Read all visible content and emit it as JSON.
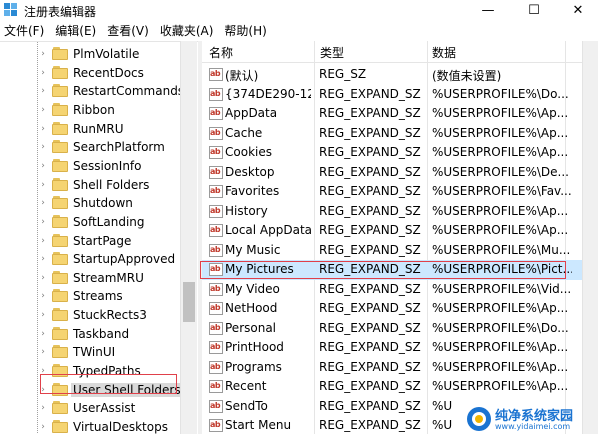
{
  "window": {
    "title": "注册表编辑器",
    "controls": {
      "minimize": "—",
      "maximize": "☐",
      "close": "✕"
    }
  },
  "menu": [
    "文件(F)",
    "编辑(E)",
    "查看(V)",
    "收藏夹(A)",
    "帮助(H)"
  ],
  "tree": {
    "items": [
      {
        "label": "PlmVolatile",
        "expanded": false
      },
      {
        "label": "RecentDocs",
        "expanded": false
      },
      {
        "label": "RestartCommands",
        "expanded": false
      },
      {
        "label": "Ribbon",
        "expanded": false
      },
      {
        "label": "RunMRU",
        "expanded": false
      },
      {
        "label": "SearchPlatform",
        "expanded": false
      },
      {
        "label": "SessionInfo",
        "expanded": false
      },
      {
        "label": "Shell Folders",
        "expanded": false
      },
      {
        "label": "Shutdown",
        "expanded": false
      },
      {
        "label": "SoftLanding",
        "expanded": false
      },
      {
        "label": "StartPage",
        "expanded": false
      },
      {
        "label": "StartupApproved",
        "expanded": false
      },
      {
        "label": "StreamMRU",
        "expanded": false
      },
      {
        "label": "Streams",
        "expanded": false
      },
      {
        "label": "StuckRects3",
        "expanded": false
      },
      {
        "label": "Taskband",
        "expanded": false
      },
      {
        "label": "TWinUI",
        "expanded": false
      },
      {
        "label": "TypedPaths",
        "expanded": false
      },
      {
        "label": "User Shell Folders",
        "expanded": false,
        "selected": true
      },
      {
        "label": "UserAssist",
        "expanded": false
      },
      {
        "label": "VirtualDesktops",
        "expanded": false
      }
    ]
  },
  "list": {
    "columns": {
      "name": "名称",
      "type": "类型",
      "data": "数据"
    },
    "rows": [
      {
        "name": "(默认)",
        "type": "REG_SZ",
        "data": "(数值未设置)"
      },
      {
        "name": "{374DE290-12...",
        "type": "REG_EXPAND_SZ",
        "data": "%USERPROFILE%\\Do..."
      },
      {
        "name": "AppData",
        "type": "REG_EXPAND_SZ",
        "data": "%USERPROFILE%\\Ap..."
      },
      {
        "name": "Cache",
        "type": "REG_EXPAND_SZ",
        "data": "%USERPROFILE%\\Ap..."
      },
      {
        "name": "Cookies",
        "type": "REG_EXPAND_SZ",
        "data": "%USERPROFILE%\\Ap..."
      },
      {
        "name": "Desktop",
        "type": "REG_EXPAND_SZ",
        "data": "%USERPROFILE%\\De..."
      },
      {
        "name": "Favorites",
        "type": "REG_EXPAND_SZ",
        "data": "%USERPROFILE%\\Fav..."
      },
      {
        "name": "History",
        "type": "REG_EXPAND_SZ",
        "data": "%USERPROFILE%\\Ap..."
      },
      {
        "name": "Local AppData",
        "type": "REG_EXPAND_SZ",
        "data": "%USERPROFILE%\\Ap..."
      },
      {
        "name": "My Music",
        "type": "REG_EXPAND_SZ",
        "data": "%USERPROFILE%\\Mu..."
      },
      {
        "name": "My Pictures",
        "type": "REG_EXPAND_SZ",
        "data": "%USERPROFILE%\\Pict...",
        "selected": true
      },
      {
        "name": "My Video",
        "type": "REG_EXPAND_SZ",
        "data": "%USERPROFILE%\\Vid..."
      },
      {
        "name": "NetHood",
        "type": "REG_EXPAND_SZ",
        "data": "%USERPROFILE%\\Ap..."
      },
      {
        "name": "Personal",
        "type": "REG_EXPAND_SZ",
        "data": "%USERPROFILE%\\Do..."
      },
      {
        "name": "PrintHood",
        "type": "REG_EXPAND_SZ",
        "data": "%USERPROFILE%\\Ap..."
      },
      {
        "name": "Programs",
        "type": "REG_EXPAND_SZ",
        "data": "%USERPROFILE%\\Ap..."
      },
      {
        "name": "Recent",
        "type": "REG_EXPAND_SZ",
        "data": "%USERPROFILE%\\Ap..."
      },
      {
        "name": "SendTo",
        "type": "REG_EXPAND_SZ",
        "data": "%U"
      },
      {
        "name": "Start Menu",
        "type": "REG_EXPAND_SZ",
        "data": "%U"
      }
    ]
  },
  "watermark": {
    "title": "纯净系统家园",
    "url": "www.yidaimei.com"
  },
  "colors": {
    "selection": "#cce8ff",
    "highlight_box": "#e0404a",
    "watermark": "#1a73d1"
  }
}
